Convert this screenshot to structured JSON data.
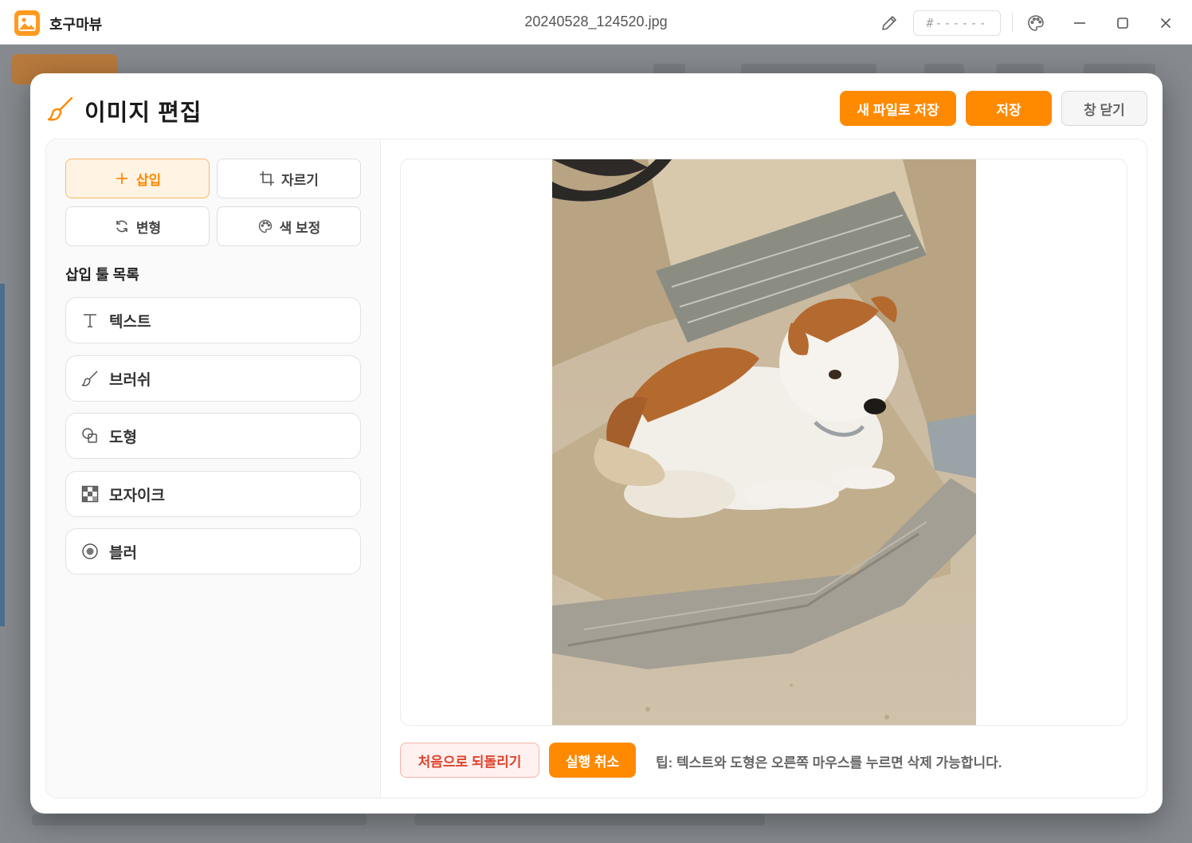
{
  "titlebar": {
    "app_name": "호구마뷰",
    "file_name": "20240528_124520.jpg",
    "hex_placeholder": "#------"
  },
  "modal": {
    "title": "이미지 편집",
    "save_as_label": "새 파일로 저장",
    "save_label": "저장",
    "close_label": "창 닫기"
  },
  "modes": [
    {
      "label": "삽입",
      "icon": "plus-icon",
      "active": true
    },
    {
      "label": "자르기",
      "icon": "crop-icon",
      "active": false
    },
    {
      "label": "변형",
      "icon": "rotate-icon",
      "active": false
    },
    {
      "label": "색 보정",
      "icon": "palette-icon",
      "active": false
    }
  ],
  "tools": {
    "heading": "삽입 툴 목록",
    "items": [
      {
        "label": "텍스트",
        "icon": "text-icon"
      },
      {
        "label": "브러쉬",
        "icon": "brush-icon"
      },
      {
        "label": "도형",
        "icon": "shapes-icon"
      },
      {
        "label": "모자이크",
        "icon": "mosaic-icon"
      },
      {
        "label": "블러",
        "icon": "blur-icon"
      }
    ]
  },
  "footer": {
    "reset_label": "처음으로 되돌리기",
    "undo_label": "실행 취소",
    "tip": "팁: 텍스트와 도형은 오른쪽 마우스를 누르면 삭제 가능합니다."
  },
  "colors": {
    "accent": "#ff8a00",
    "danger": "#e0432e"
  }
}
